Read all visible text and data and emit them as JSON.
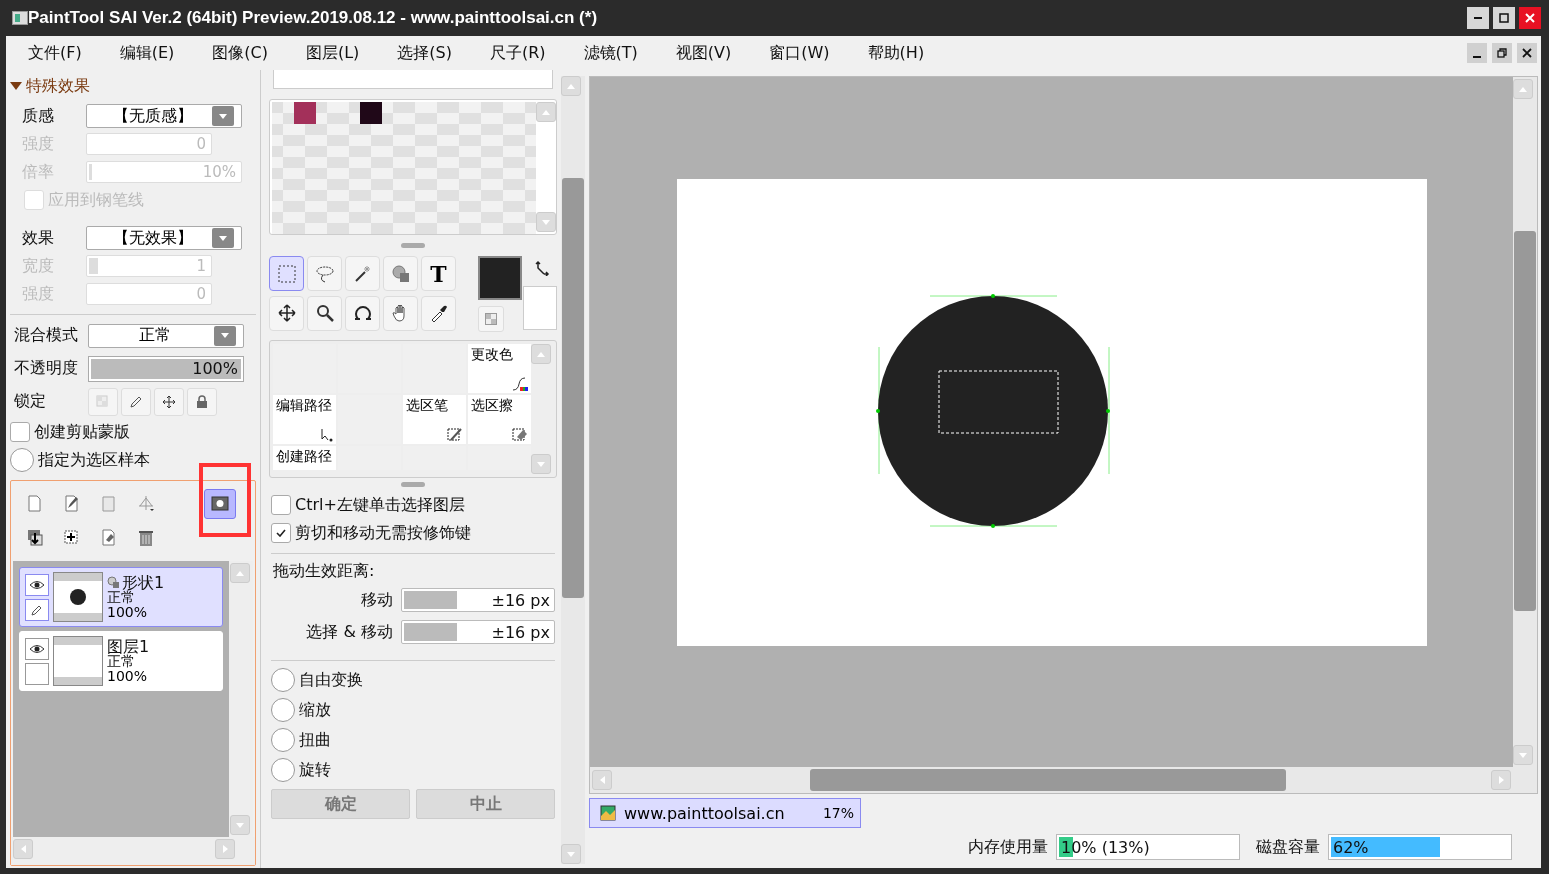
{
  "window": {
    "title": "PaintTool SAI Ver.2 (64bit) Preview.2019.08.12 - www.painttoolsai.cn (*)"
  },
  "menu": [
    {
      "label": "文件(F)"
    },
    {
      "label": "编辑(E)"
    },
    {
      "label": "图像(C)"
    },
    {
      "label": "图层(L)"
    },
    {
      "label": "选择(S)"
    },
    {
      "label": "尺子(R)"
    },
    {
      "label": "滤镜(T)"
    },
    {
      "label": "视图(V)"
    },
    {
      "label": "窗口(W)"
    },
    {
      "label": "帮助(H)"
    }
  ],
  "effects": {
    "title": "特殊效果",
    "expanded": true,
    "rows": [
      {
        "kind": "select",
        "label": "质感",
        "value": "【无质感】",
        "disabled": false
      },
      {
        "kind": "slider",
        "label": "强度",
        "value": "0",
        "level": 0,
        "disabled": true
      },
      {
        "kind": "slider",
        "label": "倍率",
        "value": "10%",
        "level": 0.02,
        "disabled": true
      },
      {
        "kind": "checkbox",
        "label": "应用到钢笔线",
        "checked": false,
        "disabled": true
      },
      {
        "kind": "select",
        "label": "效果",
        "value": "【无效果】",
        "disabled": false
      },
      {
        "kind": "slider",
        "label": "宽度",
        "value": "1",
        "level": 0.07,
        "disabled": true
      },
      {
        "kind": "slider",
        "label": "强度",
        "value": "0",
        "level": 0,
        "disabled": true
      }
    ]
  },
  "layer_props": {
    "blend": {
      "label": "混合模式",
      "value": "正常"
    },
    "opacity": {
      "label": "不透明度",
      "value": "100%",
      "level": 1
    },
    "lock": {
      "label": "锁定"
    },
    "options": [
      {
        "kind": "checkbox",
        "label": "创建剪贴蒙版",
        "checked": false
      },
      {
        "kind": "radio",
        "label": "指定为选区样本",
        "selected": false
      }
    ]
  },
  "layer_toolbar": [
    {
      "kind": "page",
      "selected": false
    },
    {
      "kind": "pen",
      "selected": false
    },
    {
      "kind": "folder",
      "selected": false
    },
    {
      "kind": "ruler",
      "selected": false
    },
    {
      "kind": "mask",
      "selected": true
    },
    {
      "kind": "merge",
      "selected": false
    },
    {
      "kind": "add",
      "selected": false
    },
    {
      "kind": "eraser",
      "selected": false
    },
    {
      "kind": "trash",
      "selected": false
    }
  ],
  "layers": [
    {
      "kind": "shape",
      "name": "形状1",
      "mode": "正常",
      "opacity": "100%",
      "selected": true,
      "visible": true,
      "editing": true
    },
    {
      "kind": "raster",
      "name": "图层1",
      "mode": "正常",
      "opacity": "100%",
      "selected": false,
      "visible": true,
      "editing": false
    }
  ],
  "palette": {
    "swatches": [
      {
        "kind": "empty"
      },
      {
        "kind": "color",
        "color": "#a3305a"
      },
      {
        "kind": "empty"
      },
      {
        "kind": "empty"
      },
      {
        "kind": "color",
        "color": "#200818"
      }
    ]
  },
  "tools": [
    {
      "kind": "marquee",
      "selected": true
    },
    {
      "kind": "lasso",
      "selected": false
    },
    {
      "kind": "wand",
      "selected": false
    },
    {
      "kind": "shape",
      "selected": false
    },
    {
      "kind": "text",
      "glyph": "T",
      "selected": false
    },
    {
      "kind": "move",
      "selected": false
    },
    {
      "kind": "zoom",
      "selected": false
    },
    {
      "kind": "rotate",
      "selected": false
    },
    {
      "kind": "hand",
      "selected": false
    },
    {
      "kind": "picker",
      "selected": false
    }
  ],
  "tool_grid": [
    {
      "kind": "empty"
    },
    {
      "kind": "empty"
    },
    {
      "kind": "empty"
    },
    {
      "kind": "tool",
      "label": "更改色"
    },
    {
      "kind": "tool",
      "label": "编辑路径"
    },
    {
      "kind": "empty"
    },
    {
      "kind": "tool",
      "label": "选区笔"
    },
    {
      "kind": "tool",
      "label": "选区擦"
    },
    {
      "kind": "tool",
      "label": "创建路径"
    },
    {
      "kind": "empty"
    },
    {
      "kind": "empty"
    },
    {
      "kind": "empty"
    }
  ],
  "tool_options": {
    "checkboxes": [
      {
        "label": "Ctrl+左键单击选择图层",
        "checked": false
      },
      {
        "label": "剪切和移动无需按修饰键",
        "checked": true
      }
    ],
    "drag_title": "拖动生效距离:",
    "drag_rows": [
      {
        "label": "移动",
        "value": "±16 px",
        "level": 0.35
      },
      {
        "label": "选择 & 移动",
        "value": "±16 px",
        "level": 0.35
      }
    ],
    "transforms": [
      {
        "label": "自由变换",
        "selected": false
      },
      {
        "label": "缩放",
        "selected": false
      },
      {
        "label": "扭曲",
        "selected": false
      },
      {
        "label": "旋转",
        "selected": false
      }
    ],
    "buttons": [
      {
        "label": "确定",
        "disabled": true
      },
      {
        "label": "中止",
        "disabled": true
      }
    ]
  },
  "document_tab": {
    "title": "www.painttoolsai.cn",
    "zoom": "17%",
    "selected": true
  },
  "status": {
    "memory": {
      "label": "内存使用量",
      "value": "10% (13%)",
      "level": 0.1
    },
    "disk": {
      "label": "磁盘容量",
      "value": "62%",
      "level": 0.62
    }
  }
}
